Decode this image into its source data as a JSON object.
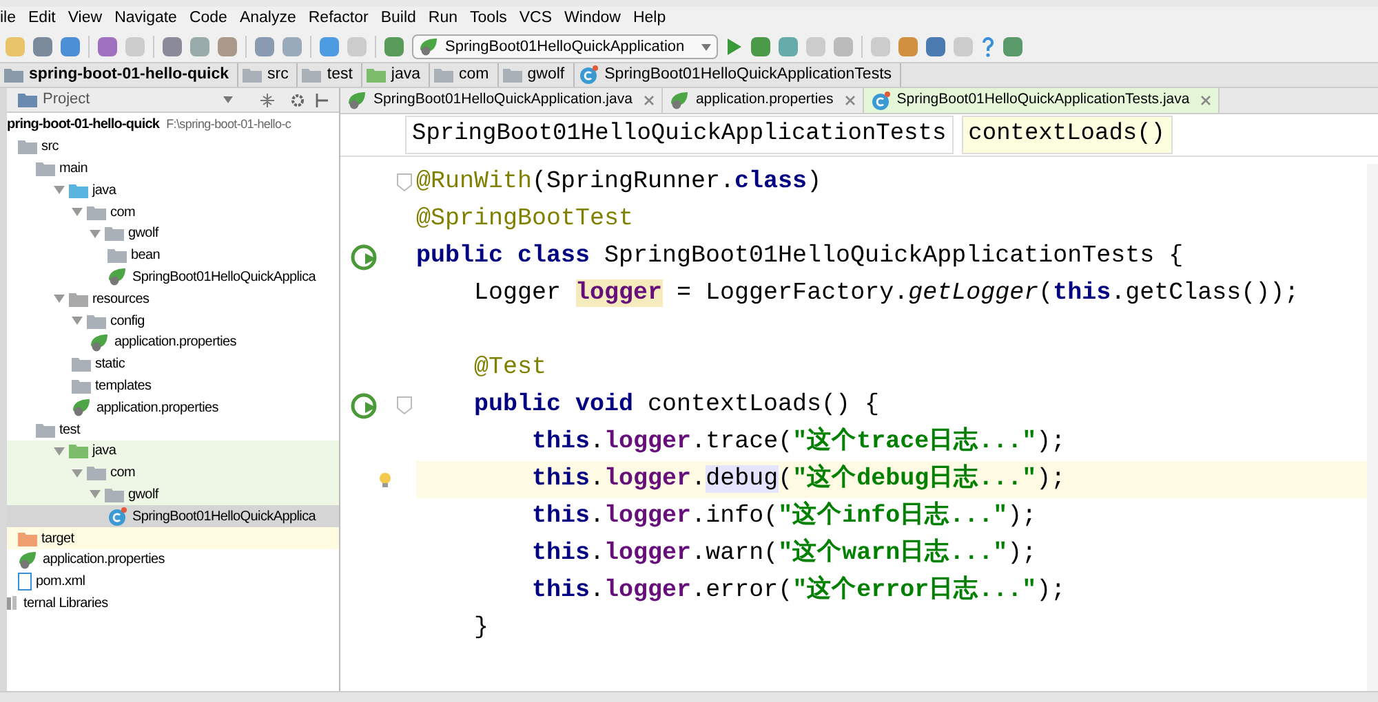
{
  "menu": [
    "ile",
    "Edit",
    "View",
    "Navigate",
    "Code",
    "Analyze",
    "Refactor",
    "Build",
    "Run",
    "Tools",
    "VCS",
    "Window",
    "Help"
  ],
  "toolbar": {
    "run_config": "SpringBoot01HelloQuickApplication"
  },
  "nav_bar": [
    {
      "label": "spring-boot-01-hello-quick",
      "kind": "module"
    },
    {
      "label": "src",
      "kind": "folder"
    },
    {
      "label": "test",
      "kind": "folder"
    },
    {
      "label": "java",
      "kind": "test"
    },
    {
      "label": "com",
      "kind": "folder"
    },
    {
      "label": "gwolf",
      "kind": "folder"
    },
    {
      "label": "SpringBoot01HelloQuickApplicationTests",
      "kind": "test-class"
    }
  ],
  "project_panel": {
    "title": "Project",
    "tree": [
      {
        "label": "pring-boot-01-hello-quick",
        "path": "F:\\spring-boot-01-hello-c",
        "kind": "root",
        "children": [
          {
            "label": "src",
            "kind": "folder",
            "children": [
              {
                "label": "main",
                "kind": "folder",
                "children": [
                  {
                    "label": "java",
                    "kind": "source",
                    "expanded": true,
                    "children": [
                      {
                        "label": "com",
                        "kind": "folder",
                        "expanded": true,
                        "children": [
                          {
                            "label": "gwolf",
                            "kind": "folder",
                            "expanded": true,
                            "children": [
                              {
                                "label": "bean",
                                "kind": "folder"
                              },
                              {
                                "label": "SpringBoot01HelloQuickApplica",
                                "kind": "spring-class"
                              }
                            ]
                          }
                        ]
                      }
                    ]
                  },
                  {
                    "label": "resources",
                    "kind": "resources",
                    "expanded": true,
                    "children": [
                      {
                        "label": "config",
                        "kind": "folder",
                        "expanded": true,
                        "children": [
                          {
                            "label": "application.properties",
                            "kind": "properties"
                          }
                        ]
                      },
                      {
                        "label": "static",
                        "kind": "folder"
                      },
                      {
                        "label": "templates",
                        "kind": "folder"
                      },
                      {
                        "label": "application.properties",
                        "kind": "properties"
                      }
                    ]
                  }
                ]
              },
              {
                "label": "test",
                "kind": "folder",
                "children": [
                  {
                    "label": "java",
                    "kind": "test",
                    "expanded": true,
                    "test_scope": true,
                    "children": [
                      {
                        "label": "com",
                        "kind": "folder",
                        "expanded": true,
                        "test_scope": true,
                        "children": [
                          {
                            "label": "gwolf",
                            "kind": "folder",
                            "expanded": true,
                            "test_scope": true,
                            "children": [
                              {
                                "label": "SpringBoot01HelloQuickApplica",
                                "kind": "test-class",
                                "selected": true
                              }
                            ]
                          }
                        ]
                      }
                    ]
                  }
                ]
              }
            ]
          },
          {
            "label": "target",
            "kind": "target",
            "excluded": true
          },
          {
            "label": "application.properties",
            "kind": "properties"
          },
          {
            "label": "pom.xml",
            "kind": "xml"
          }
        ]
      },
      {
        "label": "ternal Libraries",
        "kind": "libraries"
      }
    ]
  },
  "editor_tabs": [
    {
      "label": "SpringBoot01HelloQuickApplication.java",
      "kind": "spring-class",
      "selected": false
    },
    {
      "label": "application.properties",
      "kind": "properties",
      "selected": false
    },
    {
      "label": "SpringBoot01HelloQuickApplicationTests.java",
      "kind": "test-class",
      "selected": true
    }
  ],
  "editor_breadcrumbs": [
    {
      "label": "SpringBoot01HelloQuickApplicationTests",
      "selected": false
    },
    {
      "label": "contextLoads()",
      "selected": true
    }
  ],
  "code": [
    {
      "kind": "fold",
      "segments": [
        {
          "text": "@RunWith",
          "kind": "annotation"
        },
        {
          "text": "(SpringRunner.",
          "kind": "plain"
        },
        {
          "text": "class",
          "kind": "keyword"
        },
        {
          "text": ")",
          "kind": "plain"
        }
      ]
    },
    {
      "kind": "plain",
      "segments": [
        {
          "text": "@SpringBootTest",
          "kind": "annotation"
        }
      ]
    },
    {
      "kind": "run",
      "segments": [
        {
          "text": "public class ",
          "kind": "keyword"
        },
        {
          "text": "SpringBoot01HelloQuickApplicationTests {",
          "kind": "plain"
        }
      ]
    },
    {
      "kind": "plain",
      "segments": [
        {
          "text": "    Logger ",
          "kind": "plain"
        },
        {
          "text": "logger",
          "kind": "field-highlight"
        },
        {
          "text": " = LoggerFactory.",
          "kind": "plain"
        },
        {
          "text": "getLogger",
          "kind": "italic"
        },
        {
          "text": "(",
          "kind": "plain"
        },
        {
          "text": "this",
          "kind": "keyword"
        },
        {
          "text": ".getClass());",
          "kind": "plain"
        }
      ]
    },
    {
      "kind": "plain"
    },
    {
      "kind": "plain",
      "segments": [
        {
          "text": "    @Test",
          "kind": "annotation"
        }
      ]
    },
    {
      "kind": "run-fold",
      "segments": [
        {
          "text": "    public void ",
          "kind": "keyword"
        },
        {
          "text": "contextLoads() {",
          "kind": "plain"
        }
      ]
    },
    {
      "kind": "plain",
      "segments": [
        {
          "text": "        this",
          "kind": "keyword"
        },
        {
          "text": ".",
          "kind": "plain"
        },
        {
          "text": "logger",
          "kind": "field"
        },
        {
          "text": ".trace(",
          "kind": "plain"
        },
        {
          "text": "\"这个trace日志...\"",
          "kind": "string"
        },
        {
          "text": ");",
          "kind": "plain"
        }
      ]
    },
    {
      "kind": "bulb",
      "current": true,
      "segments": [
        {
          "text": "        this",
          "kind": "keyword"
        },
        {
          "text": ".",
          "kind": "plain"
        },
        {
          "text": "logger",
          "kind": "field"
        },
        {
          "text": ".",
          "kind": "plain"
        },
        {
          "text": "debug",
          "kind": "usage"
        },
        {
          "text": "(",
          "kind": "plain"
        },
        {
          "text": "\"这个debug日志...\"",
          "kind": "string"
        },
        {
          "text": ");",
          "kind": "plain"
        }
      ]
    },
    {
      "kind": "plain",
      "segments": [
        {
          "text": "        this",
          "kind": "keyword"
        },
        {
          "text": ".",
          "kind": "plain"
        },
        {
          "text": "logger",
          "kind": "field"
        },
        {
          "text": ".info(",
          "kind": "plain"
        },
        {
          "text": "\"这个info日志...\"",
          "kind": "string"
        },
        {
          "text": ");",
          "kind": "plain"
        }
      ]
    },
    {
      "kind": "plain",
      "segments": [
        {
          "text": "        this",
          "kind": "keyword"
        },
        {
          "text": ".",
          "kind": "plain"
        },
        {
          "text": "logger",
          "kind": "field"
        },
        {
          "text": ".warn(",
          "kind": "plain"
        },
        {
          "text": "\"这个warn日志...\"",
          "kind": "string"
        },
        {
          "text": ");",
          "kind": "plain"
        }
      ]
    },
    {
      "kind": "plain",
      "segments": [
        {
          "text": "        this",
          "kind": "keyword"
        },
        {
          "text": ".",
          "kind": "plain"
        },
        {
          "text": "logger",
          "kind": "field"
        },
        {
          "text": ".error(",
          "kind": "plain"
        },
        {
          "text": "\"这个error日志...\"",
          "kind": "string"
        },
        {
          "text": ");",
          "kind": "plain"
        }
      ]
    },
    {
      "kind": "plain",
      "segments": [
        {
          "text": "    }",
          "kind": "plain"
        }
      ]
    }
  ]
}
